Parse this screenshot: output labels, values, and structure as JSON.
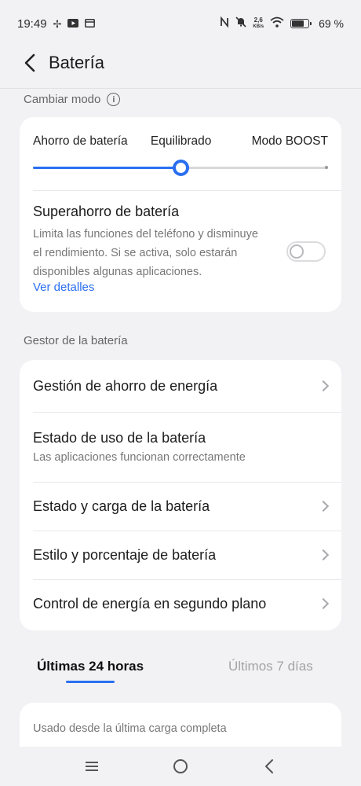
{
  "status_bar": {
    "time": "19:49",
    "net_speed_value": "2,6",
    "net_speed_unit": "KB/s",
    "battery_percent": "69 %",
    "battery_level": 0.69
  },
  "header": {
    "title": "Batería"
  },
  "mode_section": {
    "label": "Cambiar modo",
    "options": [
      "Ahorro de batería",
      "Equilibrado",
      "Modo BOOST"
    ],
    "selected_index": 1,
    "slider_value": 0.5
  },
  "super_saver": {
    "title": "Superahorro de batería",
    "description": "Limita las funciones del teléfono y disminuye el rendimiento. Si se activa, solo estarán disponibles algunas aplicaciones.",
    "link": "Ver detalles",
    "enabled": false
  },
  "manager_section": {
    "label": "Gestor de la batería",
    "items": [
      {
        "title": "Gestión de ahorro de energía",
        "subtitle": ""
      },
      {
        "title": "Estado de uso de la batería",
        "subtitle": "Las aplicaciones funcionan correctamente"
      },
      {
        "title": "Estado y carga de la batería",
        "subtitle": ""
      },
      {
        "title": "Estilo y porcentaje de batería",
        "subtitle": ""
      },
      {
        "title": "Control de energía en segundo plano",
        "subtitle": ""
      }
    ]
  },
  "usage_tabs": {
    "tabs": [
      "Últimas 24 horas",
      "Últimos 7 días"
    ],
    "active_index": 0
  },
  "usage_card": {
    "label": "Usado desde la última carga completa"
  },
  "colors": {
    "accent": "#2a6ff0",
    "background": "#f2f2f4",
    "card": "#ffffff"
  },
  "icons": [
    "fan-icon",
    "youtube-icon",
    "window-icon",
    "nfc-icon",
    "mute-icon",
    "wifi-icon",
    "battery-icon",
    "back-arrow-icon",
    "info-icon",
    "chevron-right-icon",
    "menu-icon",
    "home-circle-icon",
    "back-triangle-icon"
  ]
}
